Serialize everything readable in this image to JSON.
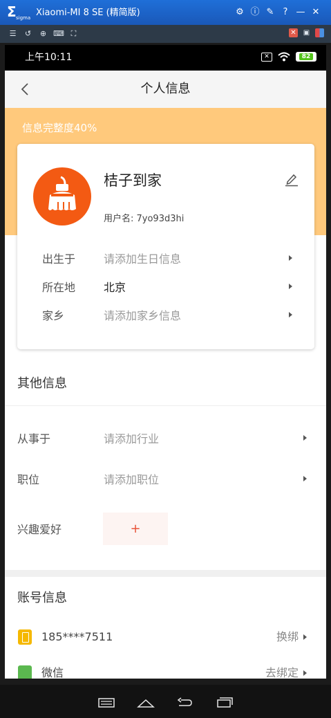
{
  "window": {
    "title": "Xiaomi-MI 8 SE (精简版)",
    "logo": "Σ",
    "logo_sub": "sigma",
    "controls": [
      "gear-icon",
      "info-icon",
      "pin-icon",
      "help-icon",
      "minimize-icon",
      "close-icon"
    ]
  },
  "toolbar": {
    "left_icons": [
      "list-icon",
      "rotate-icon",
      "zoom-icon",
      "keyboard-icon",
      "fullscreen-icon"
    ],
    "right_icons": [
      "mute-icon",
      "screenshot-icon",
      "apps-icon"
    ]
  },
  "status_bar": {
    "time": "上午10:11",
    "battery": "82"
  },
  "nav": {
    "title": "个人信息"
  },
  "profile": {
    "completion": "信息完整度40%",
    "nickname": "桔子到家",
    "username": "用户名: 7yo93d3hi",
    "rows": [
      {
        "label": "出生于",
        "value": "请添加生日信息"
      },
      {
        "label": "所在地",
        "value": "北京"
      },
      {
        "label": "家乡",
        "value": "请添加家乡信息"
      }
    ]
  },
  "other_info": {
    "title": "其他信息",
    "rows": [
      {
        "label": "从事于",
        "value": "请添加行业"
      },
      {
        "label": "职位",
        "value": "请添加职位"
      }
    ],
    "hobby_label": "兴趣爱好",
    "hobby_add": "+"
  },
  "account_info": {
    "title": "账号信息",
    "phone": "185****7511",
    "phone_action": "换绑",
    "wechat": "微信",
    "wechat_action": "去绑定"
  },
  "colors": {
    "accent_band": "#ffc97c",
    "avatar_bg": "#f35a13",
    "hobby_add": "#e8543a"
  }
}
